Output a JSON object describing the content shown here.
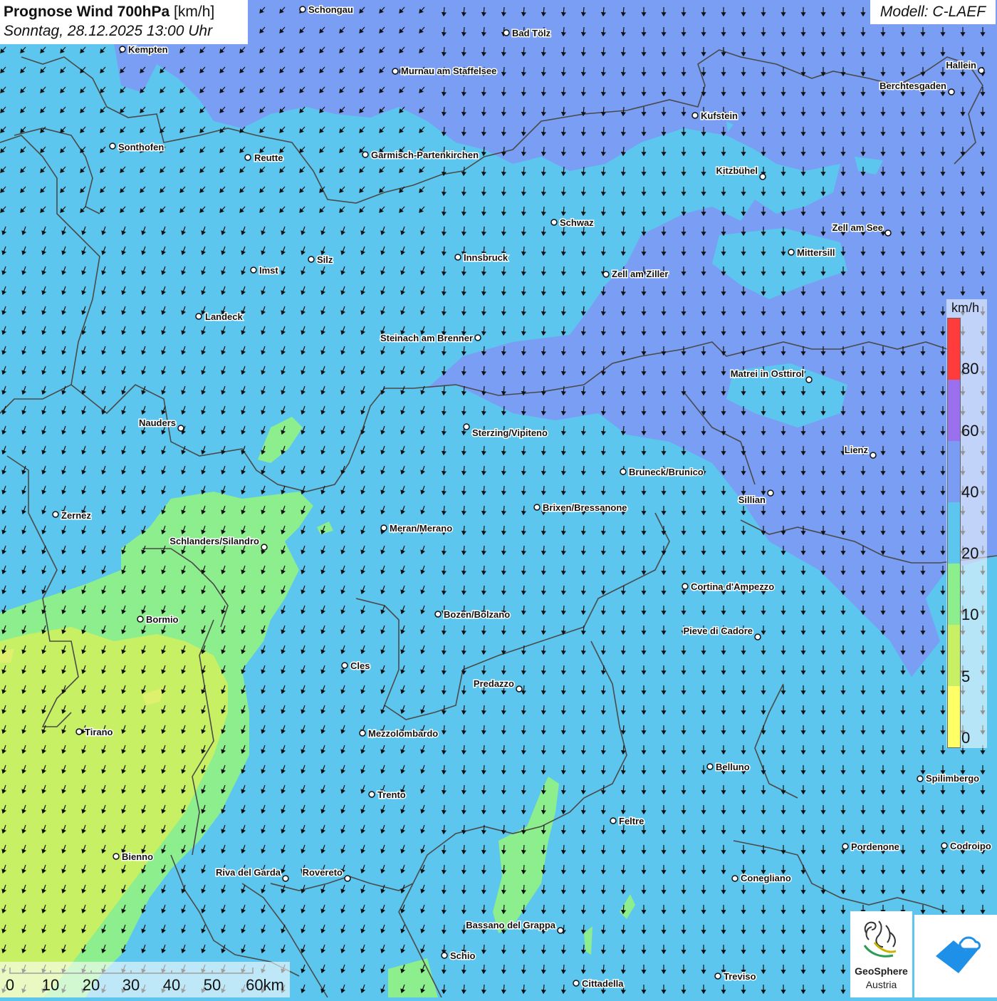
{
  "header": {
    "title": "Prognose Wind 700hPa",
    "unit": "[km/h]",
    "datetime": "Sonntag, 28.12.2025 13:00 Uhr"
  },
  "model": "Modell: C-LAEF",
  "colors": {
    "band_0_5": "#ffff66",
    "band_5_10": "#c8f064",
    "band_10_20": "#8cee8c",
    "band_20_40": "#5cc6ee",
    "band_40_60": "#7a9cf2",
    "band_60_80": "#9a70ee",
    "band_80_plus": "#ff3b3b",
    "border": "#4a4a4a"
  },
  "legend": {
    "unit": "km/h",
    "ticks": [
      "80",
      "60",
      "40",
      "20",
      "10",
      "5",
      "0"
    ],
    "band_colors": [
      "#ff3b3b",
      "#9a70ee",
      "#7a9cf2",
      "#5cc6ee",
      "#8cee8c",
      "#c8f064",
      "#ffff66"
    ]
  },
  "scale_bar": {
    "labels": [
      "0",
      "10",
      "20",
      "30",
      "40",
      "50",
      "60km"
    ]
  },
  "places": [
    {
      "name": "Schongau"
    },
    {
      "name": "Bad Tölz"
    },
    {
      "name": "Kempten"
    },
    {
      "name": "Murnau am Staffelsee"
    },
    {
      "name": "Hallein"
    },
    {
      "name": "Berchtesgaden"
    },
    {
      "name": "Kufstein"
    },
    {
      "name": "Sonthofen"
    },
    {
      "name": "Reutte"
    },
    {
      "name": "Garmisch-Partenkirchen"
    },
    {
      "name": "Kitzbühel"
    },
    {
      "name": "Schwaz"
    },
    {
      "name": "Zell am See"
    },
    {
      "name": "Mittersill"
    },
    {
      "name": "Innsbruck"
    },
    {
      "name": "Silz"
    },
    {
      "name": "Imst"
    },
    {
      "name": "Zell am Ziller"
    },
    {
      "name": "Landeck"
    },
    {
      "name": "Steinach am Brenner"
    },
    {
      "name": "Matrei in Osttirol"
    },
    {
      "name": "Nauders"
    },
    {
      "name": "Sterzing/Vipiteno"
    },
    {
      "name": "Lienz"
    },
    {
      "name": "Bruneck/Brunico"
    },
    {
      "name": "Sillian"
    },
    {
      "name": "Brixen/Bressanone"
    },
    {
      "name": "Zernez"
    },
    {
      "name": "Meran/Merano"
    },
    {
      "name": "Schlanders/Silandro"
    },
    {
      "name": "Cortina d'Ampezzo"
    },
    {
      "name": "Bozen/Bolzano"
    },
    {
      "name": "Bormio"
    },
    {
      "name": "Pieve di Cadore"
    },
    {
      "name": "Cles"
    },
    {
      "name": "Predazzo"
    },
    {
      "name": "Tirano"
    },
    {
      "name": "Mezzolombardo"
    },
    {
      "name": "Belluno"
    },
    {
      "name": "Spilimbergo"
    },
    {
      "name": "Trento"
    },
    {
      "name": "Feltre"
    },
    {
      "name": "Pordenone"
    },
    {
      "name": "Codroipo"
    },
    {
      "name": "Bienno"
    },
    {
      "name": "Riva del Garda"
    },
    {
      "name": "Rovereto"
    },
    {
      "name": "Conegliano"
    },
    {
      "name": "Bassano del Grappa"
    },
    {
      "name": "Schio"
    },
    {
      "name": "Treviso"
    },
    {
      "name": "Cittadella"
    }
  ],
  "wind": {
    "direction": "from north-northeast, arrows pointing south-southwest"
  },
  "logos": {
    "geosphere_name": "GeoSphere",
    "geosphere_sub": "Austria",
    "geosphere_icon": "geosphere-austria-logo",
    "second_icon": "cloud-mountain-logo"
  }
}
